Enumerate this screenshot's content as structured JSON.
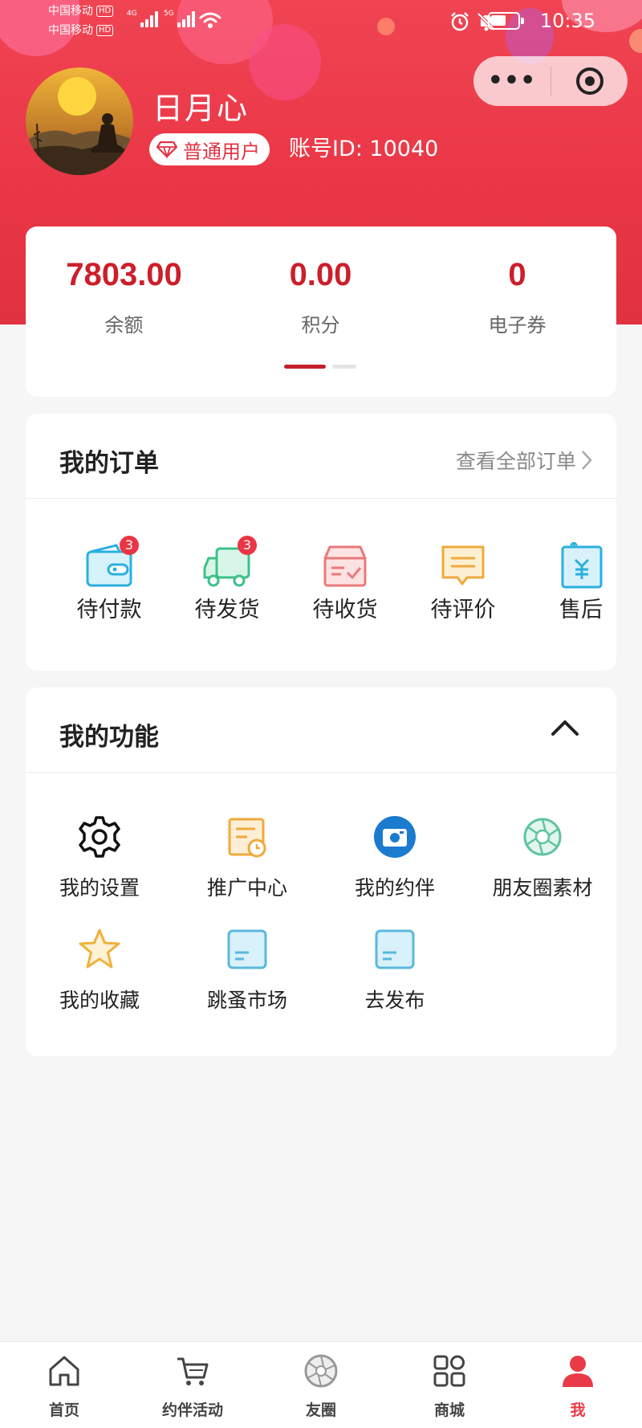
{
  "status_bar": {
    "carrier_1": "中国移动",
    "carrier_2": "中国移动",
    "hd": "HD",
    "net_1": "4G",
    "net_2": "5G",
    "time": "10:35"
  },
  "user": {
    "name": "日月心",
    "level": "普通用户",
    "account_id": "账号ID: 10040"
  },
  "stats": [
    {
      "value": "7803.00",
      "label": "余额"
    },
    {
      "value": "0.00",
      "label": "积分"
    },
    {
      "value": "0",
      "label": "电子券"
    }
  ],
  "orders": {
    "title": "我的订单",
    "view_all": "查看全部订单",
    "items": [
      {
        "label": "待付款",
        "badge": "3",
        "icon": "wallet-icon"
      },
      {
        "label": "待发货",
        "badge": "3",
        "icon": "truck-icon"
      },
      {
        "label": "待收货",
        "icon": "package-icon"
      },
      {
        "label": "待评价",
        "icon": "comment-icon"
      },
      {
        "label": "售后",
        "icon": "refund-icon"
      }
    ]
  },
  "functions": {
    "title": "我的功能",
    "items": [
      {
        "label": "我的设置",
        "icon": "gear-icon"
      },
      {
        "label": "推广中心",
        "icon": "promo-doc-icon"
      },
      {
        "label": "我的约伴",
        "icon": "camera-icon"
      },
      {
        "label": "朋友圈素材",
        "icon": "aperture-icon"
      },
      {
        "label": "我的收藏",
        "icon": "star-icon"
      },
      {
        "label": "跳蚤市场",
        "icon": "card-icon"
      },
      {
        "label": "去发布",
        "icon": "card-icon"
      }
    ]
  },
  "tabbar": [
    {
      "label": "首页",
      "icon": "home-icon"
    },
    {
      "label": "约伴活动",
      "icon": "cart-icon"
    },
    {
      "label": "友圈",
      "icon": "aperture-icon"
    },
    {
      "label": "商城",
      "icon": "grid-icon"
    },
    {
      "label": "我",
      "icon": "person-icon",
      "active": true
    }
  ],
  "colors": {
    "brand_red": "#e93a47",
    "value_red": "#cc1f2a"
  }
}
